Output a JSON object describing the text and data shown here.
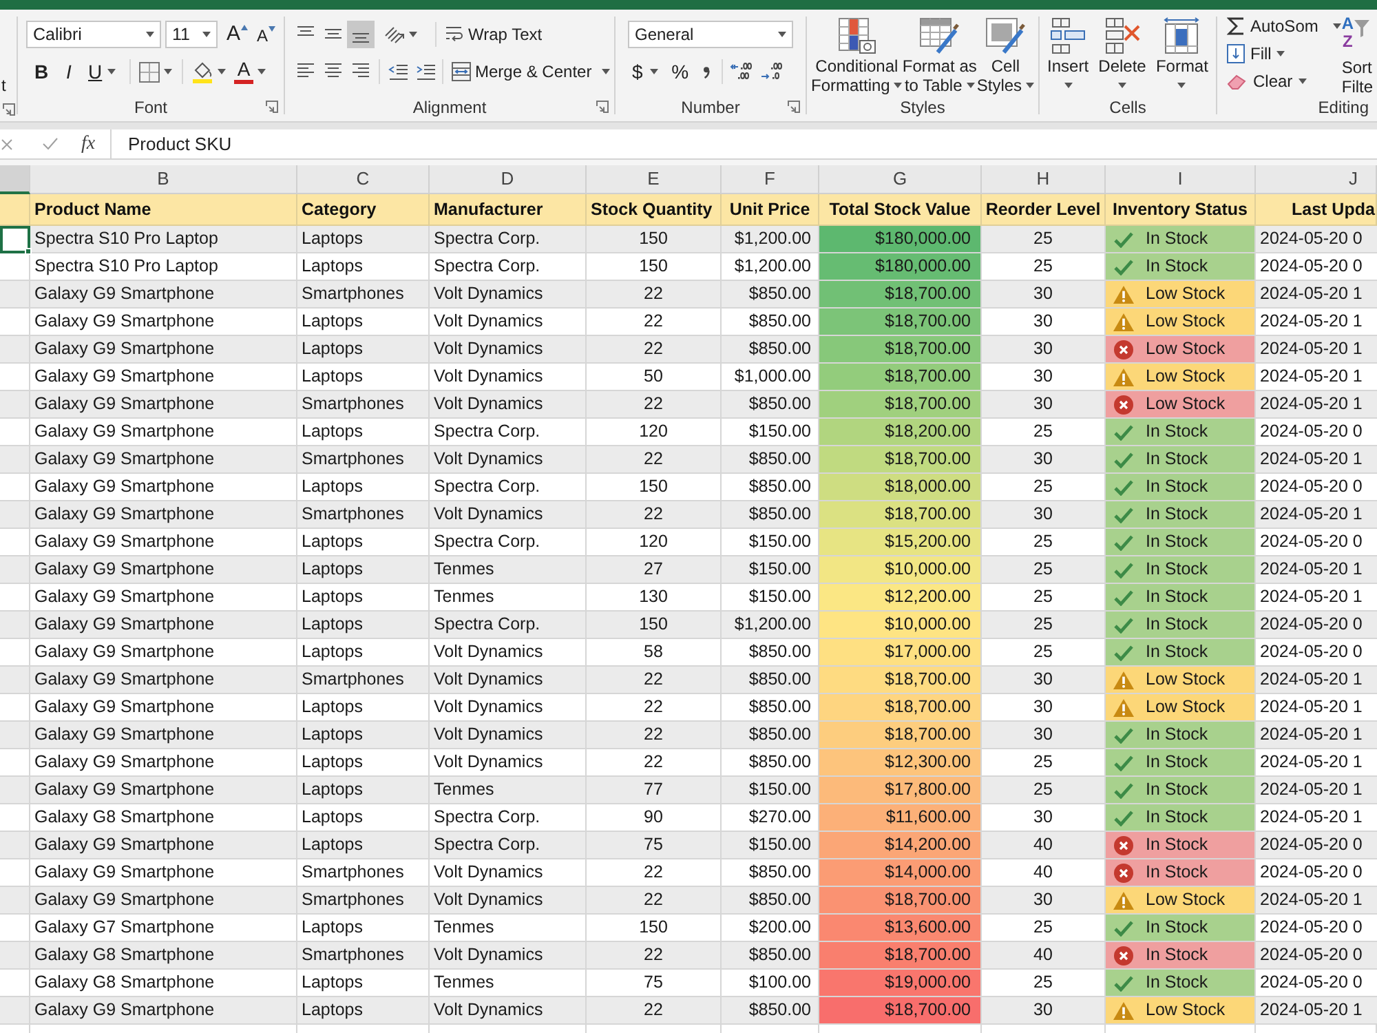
{
  "ribbon": {
    "left_cut_text": "t",
    "font": {
      "font_name": "Calibri",
      "font_size": "11",
      "grow_font": "A",
      "shrink_font": "A",
      "bold": "B",
      "italic": "I",
      "underline": "U",
      "font_color": "A",
      "label": "Font"
    },
    "alignment": {
      "vertical": [
        {
          "kind": "top",
          "selected": false
        },
        {
          "kind": "middle",
          "selected": false
        },
        {
          "kind": "bottom",
          "selected": true
        }
      ],
      "horizontal": [
        {
          "kind": "left",
          "selected": false
        },
        {
          "kind": "center",
          "selected": false
        },
        {
          "kind": "right",
          "selected": false
        }
      ],
      "wrap_text": "Wrap Text",
      "merge_center": "Merge & Center",
      "label": "Alignment"
    },
    "number": {
      "format": "General",
      "currency": "$",
      "percent": "%",
      "label": "Number"
    },
    "styles": {
      "buttons": [
        {
          "kind": "conditional",
          "lines": [
            "Conditional",
            "Formatting"
          ]
        },
        {
          "kind": "table",
          "lines": [
            "Format as",
            "to Table"
          ]
        },
        {
          "kind": "cell_styles",
          "lines": [
            "Cell",
            "Styles"
          ]
        }
      ],
      "label": "Styles"
    },
    "cells": {
      "buttons": [
        {
          "kind": "insert",
          "label": "Insert"
        },
        {
          "kind": "delete",
          "label": "Delete"
        },
        {
          "kind": "format",
          "label": "Format"
        }
      ],
      "label": "Cells"
    },
    "editing": {
      "autosum": "AutoSom",
      "fill": "Fill",
      "clear": "Clear",
      "sort_icon_letters": [
        "A",
        "Z"
      ],
      "sort_lines": [
        "Sort",
        "Filte"
      ],
      "label": "Editing"
    }
  },
  "formula_bar": {
    "function_label": "fx",
    "value": "Product SKU"
  },
  "sheet": {
    "column_headers": [
      {
        "selected": true
      },
      {
        "letter": "B",
        "selected": false
      },
      {
        "letter": "C",
        "selected": false
      },
      {
        "letter": "D",
        "selected": false
      },
      {
        "letter": "E",
        "selected": false
      },
      {
        "letter": "F",
        "selected": false
      },
      {
        "letter": "G",
        "selected": false
      },
      {
        "letter": "H",
        "selected": false
      },
      {
        "letter": "I",
        "selected": false
      },
      {
        "letter": "J",
        "selected": false
      }
    ],
    "header_row": [
      "Product Name",
      "Category",
      "Manufacturer",
      "Stock Quantity",
      "Unit Price",
      "Total Stock Value",
      "Reorder Level",
      "Inventory Status",
      "Last Upda"
    ],
    "rows": [
      {
        "selected": true,
        "product_name": "Spectra S10 Pro Laptop",
        "category": "Laptops",
        "manufacturer": "Spectra Corp.",
        "stock_quantity": "150",
        "unit_price": "$1,200.00",
        "total_stock_value": {
          "text": "$180,000.00",
          "color": "#5db86f"
        },
        "reorder_level": "25",
        "inventory_status": {
          "kind": "ok",
          "label": "In Stock"
        },
        "column_10": "2024-05-20 0"
      },
      {
        "selected": false,
        "product_name": "Spectra S10 Pro Laptop",
        "category": "Laptops",
        "manufacturer": "Spectra Corp.",
        "stock_quantity": "150",
        "unit_price": "$1,200.00",
        "total_stock_value": {
          "text": "$180,000.00",
          "color": "#66bc72"
        },
        "reorder_level": "25",
        "inventory_status": {
          "kind": "ok",
          "label": "In Stock"
        },
        "column_10": "2024-05-20 0"
      },
      {
        "selected": false,
        "product_name": "Galaxy G9 Smartphone",
        "category": "Smartphones",
        "manufacturer": "Volt Dynamics",
        "stock_quantity": "22",
        "unit_price": "$850.00",
        "total_stock_value": {
          "text": "$18,700.00",
          "color": "#71c075"
        },
        "reorder_level": "30",
        "inventory_status": {
          "kind": "warning",
          "label": "Low Stock"
        },
        "column_10": "2024-05-20 1"
      },
      {
        "selected": false,
        "product_name": "Galaxy G9 Smartphone",
        "category": "Laptops",
        "manufacturer": "Volt Dynamics",
        "stock_quantity": "22",
        "unit_price": "$850.00",
        "total_stock_value": {
          "text": "$18,700.00",
          "color": "#7cc478"
        },
        "reorder_level": "30",
        "inventory_status": {
          "kind": "warning",
          "label": "Low Stock"
        },
        "column_10": "2024-05-20 1"
      },
      {
        "selected": false,
        "product_name": "Galaxy G9 Smartphone",
        "category": "Laptops",
        "manufacturer": "Volt Dynamics",
        "stock_quantity": "22",
        "unit_price": "$850.00",
        "total_stock_value": {
          "text": "$18,700.00",
          "color": "#87c87a"
        },
        "reorder_level": "30",
        "inventory_status": {
          "kind": "error",
          "label": "Low Stock"
        },
        "column_10": "2024-05-20 1"
      },
      {
        "selected": false,
        "product_name": "Galaxy G9 Smartphone",
        "category": "Laptops",
        "manufacturer": "Volt Dynamics",
        "stock_quantity": "50",
        "unit_price": "$1,000.00",
        "total_stock_value": {
          "text": "$18,700.00",
          "color": "#93cc7c"
        },
        "reorder_level": "30",
        "inventory_status": {
          "kind": "warning",
          "label": "Low Stock"
        },
        "column_10": "2024-05-20 1"
      },
      {
        "selected": false,
        "product_name": "Galaxy G9 Smartphone",
        "category": "Smartphones",
        "manufacturer": "Volt Dynamics",
        "stock_quantity": "22",
        "unit_price": "$850.00",
        "total_stock_value": {
          "text": "$18,700.00",
          "color": "#a0d07e"
        },
        "reorder_level": "30",
        "inventory_status": {
          "kind": "error",
          "label": "Low Stock"
        },
        "column_10": "2024-05-20 1"
      },
      {
        "selected": false,
        "product_name": "Galaxy G9 Smartphone",
        "category": "Laptops",
        "manufacturer": "Spectra Corp.",
        "stock_quantity": "120",
        "unit_price": "$150.00",
        "total_stock_value": {
          "text": "$18,200.00",
          "color": "#b1d57f"
        },
        "reorder_level": "25",
        "inventory_status": {
          "kind": "ok",
          "label": "In Stock"
        },
        "column_10": "2024-05-20 0"
      },
      {
        "selected": false,
        "product_name": "Galaxy G9 Smartphone",
        "category": "Smartphones",
        "manufacturer": "Volt Dynamics",
        "stock_quantity": "22",
        "unit_price": "$850.00",
        "total_stock_value": {
          "text": "$18,700.00",
          "color": "#c0da80"
        },
        "reorder_level": "30",
        "inventory_status": {
          "kind": "ok",
          "label": "In Stock"
        },
        "column_10": "2024-05-20 1"
      },
      {
        "selected": false,
        "product_name": "Galaxy G9 Smartphone",
        "category": "Laptops",
        "manufacturer": "Spectra Corp.",
        "stock_quantity": "150",
        "unit_price": "$850.00",
        "total_stock_value": {
          "text": "$18,000.00",
          "color": "#cedd81"
        },
        "reorder_level": "25",
        "inventory_status": {
          "kind": "ok",
          "label": "In Stock"
        },
        "column_10": "2024-05-20 0"
      },
      {
        "selected": false,
        "product_name": "Galaxy G9 Smartphone",
        "category": "Smartphones",
        "manufacturer": "Volt Dynamics",
        "stock_quantity": "22",
        "unit_price": "$850.00",
        "total_stock_value": {
          "text": "$18,700.00",
          "color": "#dbe182"
        },
        "reorder_level": "30",
        "inventory_status": {
          "kind": "ok",
          "label": "In Stock"
        },
        "column_10": "2024-05-20 1"
      },
      {
        "selected": false,
        "product_name": "Galaxy G9 Smartphone",
        "category": "Laptops",
        "manufacturer": "Spectra Corp.",
        "stock_quantity": "120",
        "unit_price": "$150.00",
        "total_stock_value": {
          "text": "$15,200.00",
          "color": "#e7e483"
        },
        "reorder_level": "25",
        "inventory_status": {
          "kind": "ok",
          "label": "In Stock"
        },
        "column_10": "2024-05-20 0"
      },
      {
        "selected": false,
        "product_name": "Galaxy G9 Smartphone",
        "category": "Laptops",
        "manufacturer": "Tenmes",
        "stock_quantity": "27",
        "unit_price": "$150.00",
        "total_stock_value": {
          "text": "$10,000.00",
          "color": "#f2e684"
        },
        "reorder_level": "25",
        "inventory_status": {
          "kind": "ok",
          "label": "In Stock"
        },
        "column_10": "2024-05-20 1"
      },
      {
        "selected": false,
        "product_name": "Galaxy G9 Smartphone",
        "category": "Laptops",
        "manufacturer": "Tenmes",
        "stock_quantity": "130",
        "unit_price": "$150.00",
        "total_stock_value": {
          "text": "$12,200.00",
          "color": "#fbe784"
        },
        "reorder_level": "25",
        "inventory_status": {
          "kind": "ok",
          "label": "In Stock"
        },
        "column_10": "2024-05-20 1"
      },
      {
        "selected": false,
        "product_name": "Galaxy G9 Smartphone",
        "category": "Laptops",
        "manufacturer": "Spectra Corp.",
        "stock_quantity": "150",
        "unit_price": "$1,200.00",
        "total_stock_value": {
          "text": "$10,000.00",
          "color": "#fee483"
        },
        "reorder_level": "25",
        "inventory_status": {
          "kind": "ok",
          "label": "In Stock"
        },
        "column_10": "2024-05-20 0"
      },
      {
        "selected": false,
        "product_name": "Galaxy G9 Smartphone",
        "category": "Laptops",
        "manufacturer": "Volt Dynamics",
        "stock_quantity": "58",
        "unit_price": "$850.00",
        "total_stock_value": {
          "text": "$17,000.00",
          "color": "#fee082"
        },
        "reorder_level": "25",
        "inventory_status": {
          "kind": "ok",
          "label": "In Stock"
        },
        "column_10": "2024-05-20 0"
      },
      {
        "selected": false,
        "product_name": "Galaxy G9 Smartphone",
        "category": "Smartphones",
        "manufacturer": "Volt Dynamics",
        "stock_quantity": "22",
        "unit_price": "$850.00",
        "total_stock_value": {
          "text": "$18,700.00",
          "color": "#fedb81"
        },
        "reorder_level": "30",
        "inventory_status": {
          "kind": "warning",
          "label": "Low Stock"
        },
        "column_10": "2024-05-20 1"
      },
      {
        "selected": false,
        "product_name": "Galaxy G9 Smartphone",
        "category": "Laptops",
        "manufacturer": "Volt Dynamics",
        "stock_quantity": "22",
        "unit_price": "$850.00",
        "total_stock_value": {
          "text": "$18,700.00",
          "color": "#fed580"
        },
        "reorder_level": "30",
        "inventory_status": {
          "kind": "warning",
          "label": "Low Stock"
        },
        "column_10": "2024-05-20 1"
      },
      {
        "selected": false,
        "product_name": "Galaxy G9 Smartphone",
        "category": "Laptops",
        "manufacturer": "Volt Dynamics",
        "stock_quantity": "22",
        "unit_price": "$850.00",
        "total_stock_value": {
          "text": "$18,700.00",
          "color": "#fdcd7e"
        },
        "reorder_level": "30",
        "inventory_status": {
          "kind": "ok",
          "label": "In Stock"
        },
        "column_10": "2024-05-20 1"
      },
      {
        "selected": false,
        "product_name": "Galaxy G9 Smartphone",
        "category": "Laptops",
        "manufacturer": "Volt Dynamics",
        "stock_quantity": "22",
        "unit_price": "$850.00",
        "total_stock_value": {
          "text": "$12,300.00",
          "color": "#fdc47c"
        },
        "reorder_level": "25",
        "inventory_status": {
          "kind": "ok",
          "label": "In Stock"
        },
        "column_10": "2024-05-20 1"
      },
      {
        "selected": false,
        "product_name": "Galaxy G9 Smartphone",
        "category": "Laptops",
        "manufacturer": "Tenmes",
        "stock_quantity": "77",
        "unit_price": "$150.00",
        "total_stock_value": {
          "text": "$17,800.00",
          "color": "#fcba7a"
        },
        "reorder_level": "25",
        "inventory_status": {
          "kind": "ok",
          "label": "In Stock"
        },
        "column_10": "2024-05-20 1"
      },
      {
        "selected": false,
        "product_name": "Galaxy G8 Smartphone",
        "category": "Laptops",
        "manufacturer": "Spectra Corp.",
        "stock_quantity": "90",
        "unit_price": "$270.00",
        "total_stock_value": {
          "text": "$11,600.00",
          "color": "#fcb078"
        },
        "reorder_level": "30",
        "inventory_status": {
          "kind": "ok",
          "label": "In Stock"
        },
        "column_10": "2024-05-20 1"
      },
      {
        "selected": false,
        "product_name": "Galaxy G9 Smartphone",
        "category": "Laptops",
        "manufacturer": "Spectra Corp.",
        "stock_quantity": "75",
        "unit_price": "$150.00",
        "total_stock_value": {
          "text": "$14,200.00",
          "color": "#fba676"
        },
        "reorder_level": "40",
        "inventory_status": {
          "kind": "error",
          "label": "In Stock"
        },
        "column_10": "2024-05-20 0"
      },
      {
        "selected": false,
        "product_name": "Galaxy G9 Smartphone",
        "category": "Smartphones",
        "manufacturer": "Volt Dynamics",
        "stock_quantity": "22",
        "unit_price": "$850.00",
        "total_stock_value": {
          "text": "$14,000.00",
          "color": "#fb9c74"
        },
        "reorder_level": "40",
        "inventory_status": {
          "kind": "error",
          "label": "In Stock"
        },
        "column_10": "2024-05-20 0"
      },
      {
        "selected": false,
        "product_name": "Galaxy G9 Smartphone",
        "category": "Smartphones",
        "manufacturer": "Volt Dynamics",
        "stock_quantity": "22",
        "unit_price": "$850.00",
        "total_stock_value": {
          "text": "$18,700.00",
          "color": "#fa9272"
        },
        "reorder_level": "30",
        "inventory_status": {
          "kind": "warning",
          "label": "Low Stock"
        },
        "column_10": "2024-05-20 1"
      },
      {
        "selected": false,
        "product_name": "Galaxy G7 Smartphone",
        "category": "Laptops",
        "manufacturer": "Tenmes",
        "stock_quantity": "150",
        "unit_price": "$200.00",
        "total_stock_value": {
          "text": "$13,600.00",
          "color": "#fa8870"
        },
        "reorder_level": "25",
        "inventory_status": {
          "kind": "ok",
          "label": "In Stock"
        },
        "column_10": "2024-05-20 0"
      },
      {
        "selected": false,
        "product_name": "Galaxy G8 Smartphone",
        "category": "Smartphones",
        "manufacturer": "Volt Dynamics",
        "stock_quantity": "22",
        "unit_price": "$850.00",
        "total_stock_value": {
          "text": "$18,700.00",
          "color": "#f97f6e"
        },
        "reorder_level": "40",
        "inventory_status": {
          "kind": "error",
          "label": "In Stock"
        },
        "column_10": "2024-05-20 0"
      },
      {
        "selected": false,
        "product_name": "Galaxy G8 Smartphone",
        "category": "Laptops",
        "manufacturer": "Tenmes",
        "stock_quantity": "75",
        "unit_price": "$100.00",
        "total_stock_value": {
          "text": "$19,000.00",
          "color": "#f9766d"
        },
        "reorder_level": "25",
        "inventory_status": {
          "kind": "ok",
          "label": "In Stock"
        },
        "column_10": "2024-05-20 0"
      },
      {
        "selected": false,
        "product_name": "Galaxy G9 Smartphone",
        "category": "Laptops",
        "manufacturer": "Volt Dynamics",
        "stock_quantity": "22",
        "unit_price": "$850.00",
        "total_stock_value": {
          "text": "$18,700.00",
          "color": "#f86e6c"
        },
        "reorder_level": "30",
        "inventory_status": {
          "kind": "warning",
          "label": "Low Stock"
        },
        "column_10": "2024-05-20 1"
      }
    ]
  }
}
